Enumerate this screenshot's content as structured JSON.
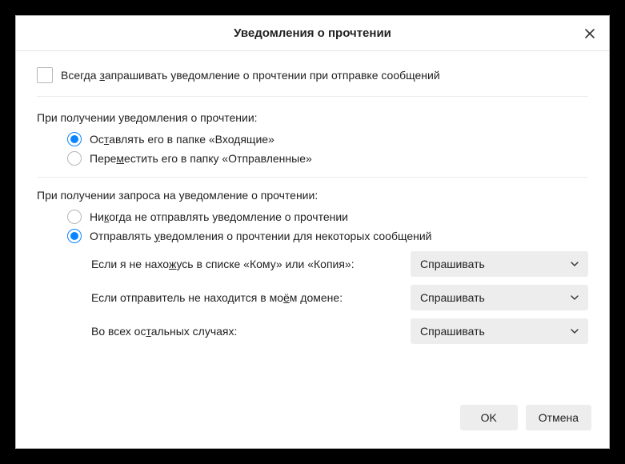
{
  "title": "Уведомления о прочтении",
  "always_request": {
    "label_pre": "Всегда ",
    "label_u": "з",
    "label_post": "апрашивать уведомление о прочтении при отправке сообщений",
    "checked": false
  },
  "on_receive_receipt": {
    "heading": "При получении уведомления о прочтении:",
    "options": [
      {
        "pre": "Ос",
        "u": "т",
        "post": "авлять его в папке «Входящие»",
        "selected": true
      },
      {
        "pre": "Пере",
        "u": "м",
        "post": "естить его в папку «Отправленные»",
        "selected": false
      }
    ]
  },
  "on_request": {
    "heading": "При получении запроса на уведомление о прочтении:",
    "options": [
      {
        "pre": "Ни",
        "u": "к",
        "post": "огда не отправлять уведомление о прочтении",
        "selected": false
      },
      {
        "pre": "Отправлять ",
        "u": "у",
        "post": "ведомления о прочтении для некоторых сообщений",
        "selected": true
      }
    ],
    "sub": [
      {
        "label_pre": "Если я не нахо",
        "label_u": "ж",
        "label_post": "усь в списке «Кому» или «Копия»:",
        "value": "Спрашивать"
      },
      {
        "label_pre": "Если отправитель не находится в мо",
        "label_u": "ё",
        "label_post": "м домене:",
        "value": "Спрашивать"
      },
      {
        "label_pre": "Во всех ос",
        "label_u": "т",
        "label_post": "альных случаях:",
        "value": "Спрашивать"
      }
    ]
  },
  "buttons": {
    "ok": "OK",
    "cancel": "Отмена"
  }
}
